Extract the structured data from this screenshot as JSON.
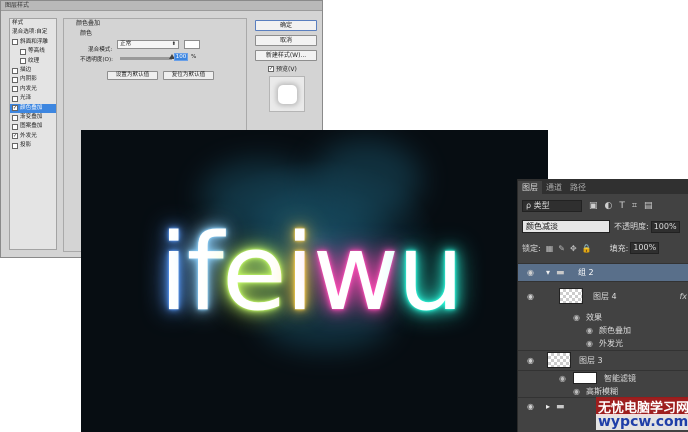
{
  "dialog": {
    "title": "图层样式",
    "style_list": {
      "header": "样式",
      "blend_default": "混合选项:自定",
      "items": [
        {
          "label": "斜面和浮雕",
          "checked": false,
          "indent": false,
          "selected": false
        },
        {
          "label": "等高线",
          "checked": false,
          "indent": true,
          "selected": false
        },
        {
          "label": "纹理",
          "checked": false,
          "indent": true,
          "selected": false
        },
        {
          "label": "描边",
          "checked": false,
          "indent": false,
          "selected": false
        },
        {
          "label": "内阴影",
          "checked": false,
          "indent": false,
          "selected": false
        },
        {
          "label": "内发光",
          "checked": false,
          "indent": false,
          "selected": false
        },
        {
          "label": "光泽",
          "checked": false,
          "indent": false,
          "selected": false
        },
        {
          "label": "颜色叠加",
          "checked": true,
          "indent": false,
          "selected": true
        },
        {
          "label": "渐变叠加",
          "checked": false,
          "indent": false,
          "selected": false
        },
        {
          "label": "图案叠加",
          "checked": false,
          "indent": false,
          "selected": false
        },
        {
          "label": "外发光",
          "checked": true,
          "indent": false,
          "selected": false
        },
        {
          "label": "投影",
          "checked": false,
          "indent": false,
          "selected": false
        }
      ]
    },
    "panel": {
      "section_title": "颜色叠加",
      "subsection_title": "颜色",
      "blend_mode_label": "混合模式:",
      "blend_mode_value": "正常",
      "select_arrow": "⬍",
      "overlay_color": "#ffffff",
      "opacity_label": "不透明度(O):",
      "opacity_value": "100",
      "opacity_fraction": 1.0,
      "opacity_unit": "%",
      "make_default_label": "设置为默认值",
      "reset_default_label": "复位为默认值"
    },
    "buttons": {
      "ok": "确定",
      "cancel": "取消",
      "new_style": "新建样式(W)..."
    },
    "preview": {
      "label": "预览(V)",
      "checked": true
    }
  },
  "canvas": {
    "letters": [
      {
        "char": "i",
        "glow": "#5a9cff"
      },
      {
        "char": "f",
        "glow": "#8fd3ff"
      },
      {
        "char": "e",
        "glow": "#c8ff6a"
      },
      {
        "char": "i",
        "glow": "#ffd24a"
      },
      {
        "char": "w",
        "glow": "#ff4fb8"
      },
      {
        "char": "u",
        "glow": "#2fffe0"
      }
    ]
  },
  "layers_panel": {
    "tabs": [
      "图层",
      "通道",
      "路径"
    ],
    "filter_select": "ρ 类型",
    "filter_icons": [
      "▣",
      "◐",
      "T",
      "⌗",
      "▤"
    ],
    "blend_mode": "颜色减淡",
    "opacity_label": "不透明度:",
    "opacity_value": "100%",
    "lock_label": "锁定:",
    "lock_icons": [
      "▦",
      "✎",
      "✥",
      "🔒"
    ],
    "fill_label": "填充:",
    "fill_value": "100%",
    "group_name": "组 2",
    "layer4_name": "图层 4",
    "effects_label": "效果",
    "color_overlay_label": "颜色叠加",
    "outer_glow_label": "外发光",
    "layer3_name": "图层 3",
    "smart_filter_label": "智能滤镜",
    "filter_list_label": "高斯模糊",
    "fx_label": "fx",
    "eye_glyph": "◉",
    "expand_glyph": "▾",
    "collapse_glyph": "▸",
    "folder_glyph": "▬"
  },
  "watermark": {
    "cn": "无忧电脑学习网",
    "en": "wypcw.com"
  }
}
